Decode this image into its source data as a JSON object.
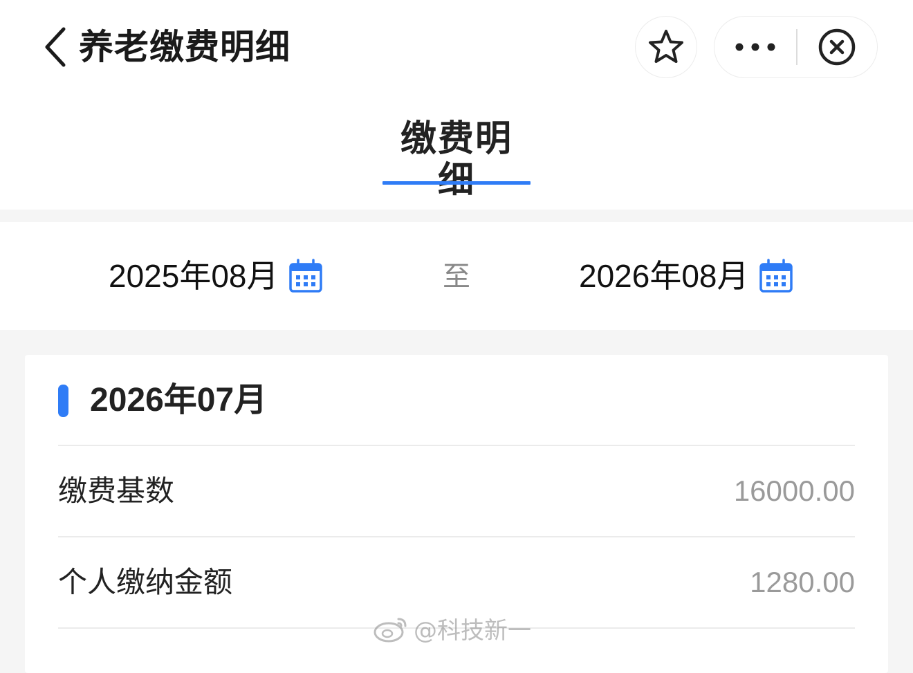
{
  "header": {
    "title": "养老缴费明细"
  },
  "tabs": [
    {
      "label": "缴费明细",
      "active": true
    }
  ],
  "date_range": {
    "start": "2025年08月",
    "separator": "至",
    "end": "2026年08月"
  },
  "record": {
    "month": "2026年07月",
    "fields": [
      {
        "label": "缴费基数",
        "value": "16000.00"
      },
      {
        "label": "个人缴纳金额",
        "value": "1280.00"
      }
    ]
  },
  "watermark": {
    "text": "@科技新一"
  },
  "colors": {
    "accent": "#2f7cf6",
    "text_primary": "#222222",
    "text_secondary": "#9a9a9a",
    "page_bg": "#f5f5f5"
  },
  "icons": {
    "back": "chevron-left-icon",
    "favorite": "star-icon",
    "more": "more-dots-icon",
    "close": "close-circle-icon",
    "calendar": "calendar-icon"
  }
}
